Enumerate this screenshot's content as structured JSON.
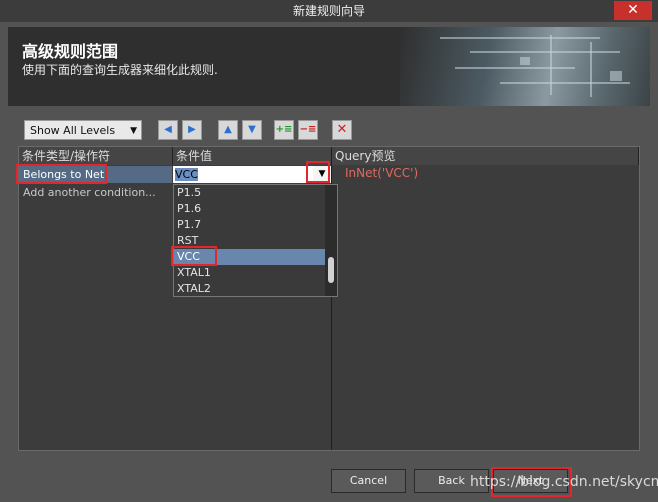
{
  "window": {
    "title": "新建规则向导",
    "close_glyph": "✕"
  },
  "banner": {
    "title": "高级规则范围",
    "subtitle": "使用下面的查询生成器来细化此规则."
  },
  "toolbar": {
    "levels_value": "Show All Levels"
  },
  "columns": {
    "condition_type": "条件类型/操作符",
    "condition_value": "条件值",
    "query_preview": "Query预览"
  },
  "condition": {
    "type_label": "Belongs to Net",
    "value": "VCC",
    "add_another": "Add another condition..."
  },
  "dropdown": {
    "items": [
      "P1.5",
      "P1.6",
      "P1.7",
      "RST",
      "VCC",
      "XTAL1",
      "XTAL2"
    ],
    "selected": "VCC"
  },
  "query": {
    "text": "InNet('VCC')"
  },
  "buttons": {
    "cancel": "Cancel",
    "back": "Back",
    "next": "Next"
  },
  "watermark": "https://blog.csdn.net/skycmq",
  "colors": {
    "highlight": "#e3262d",
    "query_text": "#e06a5e",
    "selection": "#6987ad"
  }
}
